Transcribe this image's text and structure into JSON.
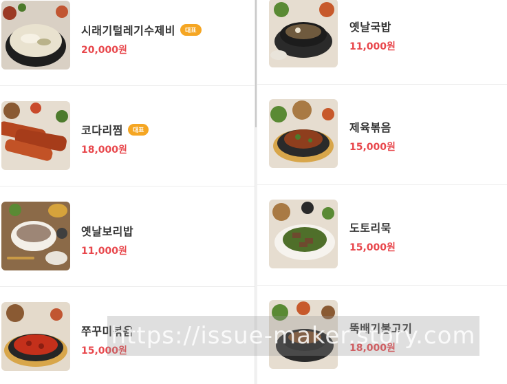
{
  "left_menu": [
    {
      "name": "시래기털레기수제비",
      "badge": "대표",
      "price": "20,000원",
      "thumb_icon": "sujebi-pot-photo"
    },
    {
      "name": "코다리찜",
      "badge": "대표",
      "price": "18,000원",
      "thumb_icon": "braised-pollock-photo"
    },
    {
      "name": "옛날보리밥",
      "badge": "",
      "price": "11,000원",
      "thumb_icon": "barley-rice-photo"
    },
    {
      "name": "쭈꾸미볶음",
      "badge": "",
      "price": "15,000원",
      "thumb_icon": "stir-fried-octopus-photo"
    }
  ],
  "right_menu": [
    {
      "name": "옛날국밥",
      "badge": "",
      "price": "11,000원",
      "thumb_icon": "gukbap-pot-photo"
    },
    {
      "name": "제육볶음",
      "badge": "",
      "price": "15,000원",
      "thumb_icon": "stir-fried-pork-photo"
    },
    {
      "name": "도토리묵",
      "badge": "",
      "price": "15,000원",
      "thumb_icon": "acorn-jelly-photo"
    },
    {
      "name": "뚝배기불고기",
      "badge": "",
      "price": "18,000원",
      "thumb_icon": "ttukbaegi-bulgogi-photo"
    }
  ],
  "watermark": "https://issue-maker.story.com",
  "colors": {
    "price": "#e8474c",
    "badge": "#f5a623"
  }
}
